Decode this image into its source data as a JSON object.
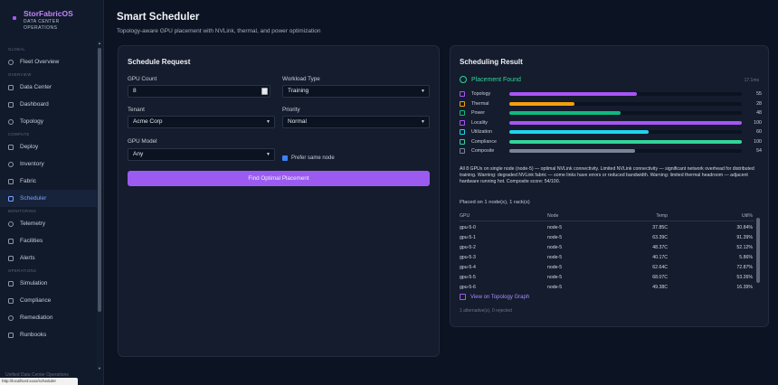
{
  "brand": {
    "title": "StorFabricOS",
    "subtitle_line1": "DATA CENTER",
    "subtitle_line2": "OPERATIONS"
  },
  "nav": {
    "sections": [
      {
        "label": "GLOBAL",
        "items": [
          {
            "label": "Fleet Overview",
            "icon": "globe-icon"
          }
        ]
      },
      {
        "label": "OVERVIEW",
        "items": [
          {
            "label": "Data Center",
            "icon": "server-icon"
          },
          {
            "label": "Dashboard",
            "icon": "dashboard-icon"
          },
          {
            "label": "Topology",
            "icon": "topology-icon"
          }
        ]
      },
      {
        "label": "COMPUTE",
        "items": [
          {
            "label": "Deploy",
            "icon": "deploy-icon"
          },
          {
            "label": "Inventory",
            "icon": "inventory-icon"
          },
          {
            "label": "Fabric",
            "icon": "fabric-icon"
          },
          {
            "label": "Scheduler",
            "icon": "scheduler-icon",
            "active": true
          }
        ]
      },
      {
        "label": "MONITORING",
        "items": [
          {
            "label": "Telemetry",
            "icon": "telemetry-icon"
          },
          {
            "label": "Facilities",
            "icon": "facilities-icon"
          },
          {
            "label": "Alerts",
            "icon": "alert-icon"
          }
        ]
      },
      {
        "label": "OPERATIONS",
        "items": [
          {
            "label": "Simulation",
            "icon": "simulation-icon"
          },
          {
            "label": "Compliance",
            "icon": "compliance-icon"
          },
          {
            "label": "Remediation",
            "icon": "remediation-icon"
          },
          {
            "label": "Runbooks",
            "icon": "runbook-icon"
          }
        ]
      }
    ],
    "footer": "Unified Data Center Operations",
    "status_url": "http://localhost:xxxx/scheduler"
  },
  "page": {
    "title": "Smart Scheduler",
    "subtitle": "Topology-aware GPU placement with NVLink, thermal, and power optimization"
  },
  "request": {
    "title": "Schedule Request",
    "gpu_count_label": "GPU Count",
    "gpu_count_value": "8",
    "workload_label": "Workload Type",
    "workload_value": "Training",
    "tenant_label": "Tenant",
    "tenant_value": "Acme Corp",
    "priority_label": "Priority",
    "priority_value": "Normal",
    "model_label": "GPU Model",
    "model_value": "Any",
    "prefer_same_node_label": "Prefer same node",
    "prefer_same_node_checked": true,
    "submit_label": "Find Optimal Placement",
    "accent": "#9b5bf0"
  },
  "result": {
    "title": "Scheduling Result",
    "status": "Placement Found",
    "elapsed": "17.1ms",
    "scores": [
      {
        "label": "Topology",
        "value": 55,
        "color": "#a855f7",
        "icon": "topology-icon"
      },
      {
        "label": "Thermal",
        "value": 28,
        "color": "#f59e0b",
        "icon": "thermometer-icon"
      },
      {
        "label": "Power",
        "value": 48,
        "color": "#10b981",
        "icon": "power-icon"
      },
      {
        "label": "Locality",
        "value": 100,
        "color": "#a855f7",
        "icon": "location-pin-icon"
      },
      {
        "label": "Utilization",
        "value": 60,
        "color": "#22d3ee",
        "icon": "utilization-icon"
      },
      {
        "label": "Compliance",
        "value": 100,
        "color": "#34d399",
        "icon": "shield-icon"
      },
      {
        "label": "Composite",
        "value": 54,
        "color": "#7a8599",
        "icon": "composite-icon"
      }
    ],
    "explanation": "All 8 GPUs on single node (node-5) — optimal NVLink connectivity. Limited NVLink connectivity — significant network overhead for distributed training. Warning: degraded NVLink fabric — some links have errors or reduced bandwidth. Warning: limited thermal headroom — adjacent hardware running hot. Composite score: 54/100.",
    "placed_summary": "Placed on 1 node(s), 1 rack(s)",
    "table": {
      "columns": [
        "GPU",
        "Node",
        "Temp",
        "Util%"
      ],
      "rows": [
        [
          "gpu-5-0",
          "node-5",
          "37.85C",
          "30.84%"
        ],
        [
          "gpu-5-1",
          "node-5",
          "63.39C",
          "91.39%"
        ],
        [
          "gpu-5-2",
          "node-5",
          "48.37C",
          "52.12%"
        ],
        [
          "gpu-5-3",
          "node-5",
          "40.17C",
          "5.86%"
        ],
        [
          "gpu-5-4",
          "node-5",
          "62.64C",
          "72.87%"
        ],
        [
          "gpu-5-5",
          "node-5",
          "68.07C",
          "53.26%"
        ],
        [
          "gpu-5-6",
          "node-5",
          "49.38C",
          "16.39%"
        ]
      ]
    },
    "topology_link": "View on Topology Graph",
    "alternatives": "1 alternative(s), 0 rejected"
  }
}
